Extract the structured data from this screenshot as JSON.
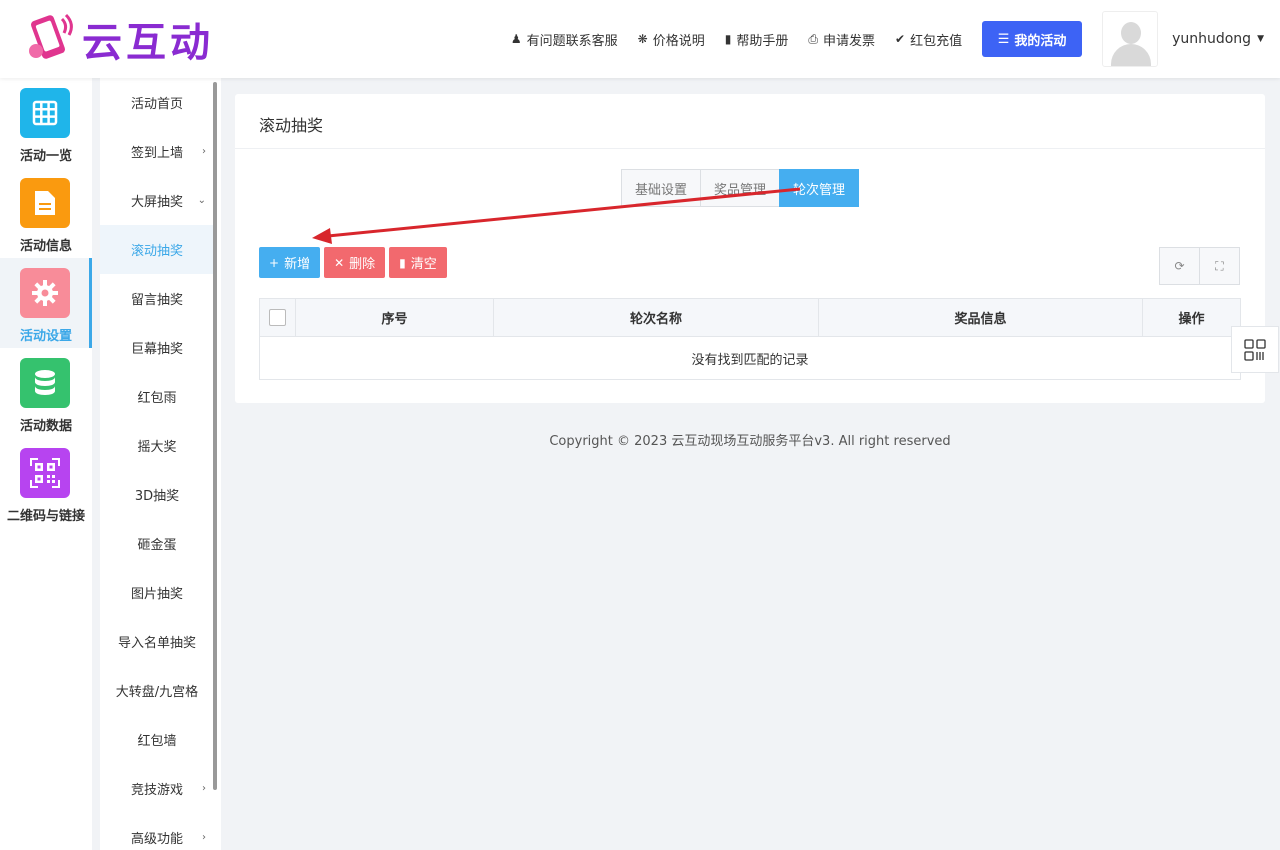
{
  "brand": {
    "name": "云互动"
  },
  "topnav": {
    "support": "有问题联系客服",
    "pricing": "价格说明",
    "help": "帮助手册",
    "invoice": "申请发票",
    "recharge": "红包充值",
    "my_activity": "我的活动",
    "username": "yunhudong"
  },
  "iconbar": {
    "items": [
      {
        "label": "活动一览",
        "color": "#1fb5ea",
        "icon": "grid-icon"
      },
      {
        "label": "活动信息",
        "color": "#fa9a0f",
        "icon": "document-icon"
      },
      {
        "label": "活动设置",
        "color": "#f88c99",
        "icon": "gear-icon"
      },
      {
        "label": "活动数据",
        "color": "#35c26e",
        "icon": "database-icon"
      },
      {
        "label": "二维码与链接",
        "color": "#b744f0",
        "icon": "qrcode-icon"
      }
    ]
  },
  "submenu": {
    "items": [
      {
        "label": "活动首页"
      },
      {
        "label": "签到上墙"
      },
      {
        "label": "大屏抽奖"
      },
      {
        "label": "滚动抽奖"
      },
      {
        "label": "留言抽奖"
      },
      {
        "label": "巨幕抽奖"
      },
      {
        "label": "红包雨"
      },
      {
        "label": "摇大奖"
      },
      {
        "label": "3D抽奖"
      },
      {
        "label": "砸金蛋"
      },
      {
        "label": "图片抽奖"
      },
      {
        "label": "导入名单抽奖"
      },
      {
        "label": "大转盘/九宫格"
      },
      {
        "label": "红包墙"
      },
      {
        "label": "竞技游戏"
      },
      {
        "label": "高级功能"
      }
    ]
  },
  "page": {
    "title": "滚动抽奖",
    "tabs": [
      "基础设置",
      "奖品管理",
      "轮次管理"
    ],
    "toolbar": {
      "add": "新增",
      "delete": "删除",
      "clear": "清空"
    },
    "table": {
      "columns": [
        "序号",
        "轮次名称",
        "奖品信息",
        "操作"
      ],
      "empty_text": "没有找到匹配的记录"
    }
  },
  "footer": {
    "text": "Copyright © 2023 云互动现场互动服务平台v3. All right reserved"
  },
  "colors": {
    "primary": "#45aef0",
    "danger": "#f2696e",
    "brand": "#8a2bd1",
    "annotation": "#d8262c"
  }
}
